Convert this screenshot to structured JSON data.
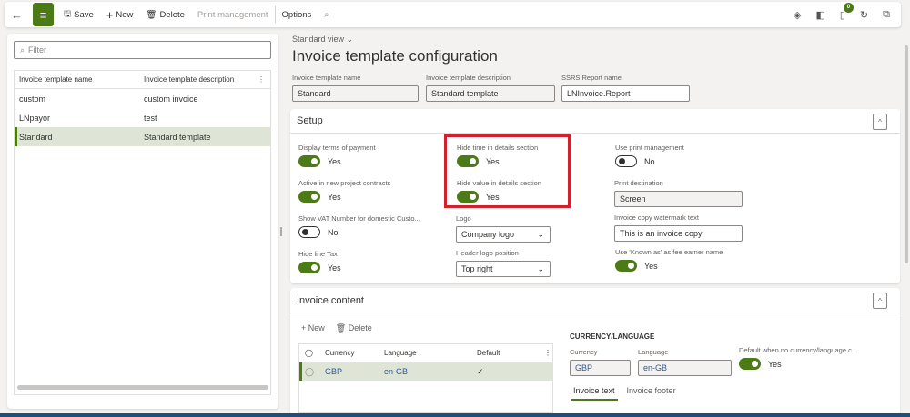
{
  "toolbar": {
    "back": "←",
    "save": "Save",
    "new": "New",
    "delete": "Delete",
    "print_management": "Print management",
    "options": "Options",
    "notification_count": "0"
  },
  "list": {
    "filter_placeholder": "Filter",
    "columns": [
      "Invoice template name",
      "Invoice template description"
    ],
    "rows": [
      {
        "name": "custom",
        "description": "custom invoice"
      },
      {
        "name": "LNpayor",
        "description": "test"
      },
      {
        "name": "Standard",
        "description": "Standard template"
      }
    ]
  },
  "header": {
    "view": "Standard view",
    "title": "Invoice template configuration",
    "name_label": "Invoice template name",
    "name_value": "Standard",
    "desc_label": "Invoice template description",
    "desc_value": "Standard template",
    "ssrs_label": "SSRS Report name",
    "ssrs_value": "LNInvoice.Report"
  },
  "setup": {
    "title": "Setup",
    "display_terms": {
      "label": "Display terms of payment",
      "value": "Yes"
    },
    "active_new": {
      "label": "Active in new project contracts",
      "value": "Yes"
    },
    "show_vat": {
      "label": "Show VAT Number for domestic Custo...",
      "value": "No"
    },
    "hide_line_tax": {
      "label": "Hide line Tax",
      "value": "Yes"
    },
    "hide_time": {
      "label": "Hide time in details section",
      "value": "Yes"
    },
    "hide_value": {
      "label": "Hide value in details section",
      "value": "Yes"
    },
    "logo": {
      "label": "Logo",
      "value": "Company logo"
    },
    "header_logo": {
      "label": "Header logo position",
      "value": "Top right"
    },
    "use_print": {
      "label": "Use print management",
      "value": "No"
    },
    "print_dest": {
      "label": "Print destination",
      "value": "Screen"
    },
    "watermark": {
      "label": "Invoice copy watermark text",
      "value": "This is an invoice copy"
    },
    "known_as": {
      "label": "Use 'Known as' as fee earner name",
      "value": "Yes"
    }
  },
  "content": {
    "title": "Invoice content",
    "new": "New",
    "delete": "Delete",
    "columns": [
      "Currency",
      "Language",
      "Default"
    ],
    "rows": [
      {
        "currency": "GBP",
        "language": "en-GB",
        "default": "✓"
      }
    ],
    "section": "CURRENCY/LANGUAGE",
    "currency_label": "Currency",
    "currency_value": "GBP",
    "language_label": "Language",
    "language_value": "en-GB",
    "default_label": "Default when no currency/language c...",
    "default_value": "Yes",
    "tabs": [
      "Invoice text",
      "Invoice footer"
    ]
  }
}
